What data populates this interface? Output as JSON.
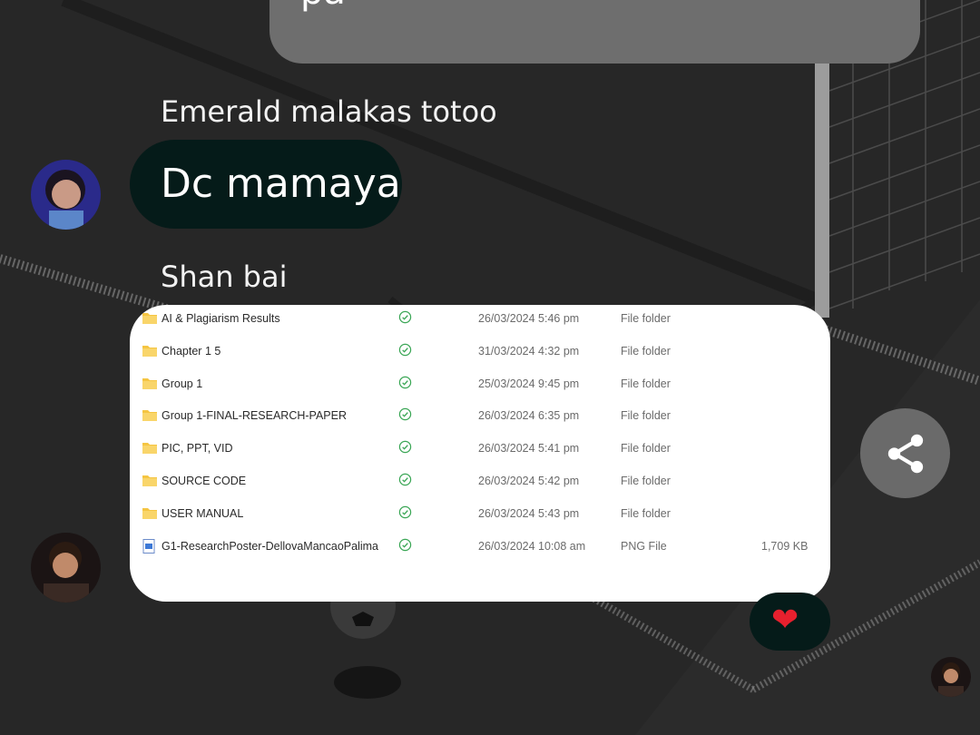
{
  "messages": {
    "top_bubble_text": "pa",
    "sender_1": "Emerald malakas totoo",
    "bubble_1_text": "Dc mamaya",
    "sender_2": "Shan bai"
  },
  "file_list": [
    {
      "name": "AI & Plagiarism Results",
      "date": "26/03/2024 5:46 pm",
      "type": "File folder",
      "size": "",
      "icon": "folder-icon"
    },
    {
      "name": "Chapter 1 5",
      "date": "31/03/2024 4:32 pm",
      "type": "File folder",
      "size": "",
      "icon": "folder-icon"
    },
    {
      "name": "Group 1",
      "date": "25/03/2024 9:45 pm",
      "type": "File folder",
      "size": "",
      "icon": "folder-icon"
    },
    {
      "name": "Group 1-FINAL-RESEARCH-PAPER",
      "date": "26/03/2024 6:35 pm",
      "type": "File folder",
      "size": "",
      "icon": "folder-icon"
    },
    {
      "name": "PIC, PPT, VID",
      "date": "26/03/2024 5:41 pm",
      "type": "File folder",
      "size": "",
      "icon": "folder-icon"
    },
    {
      "name": "SOURCE CODE",
      "date": "26/03/2024 5:42 pm",
      "type": "File folder",
      "size": "",
      "icon": "folder-icon"
    },
    {
      "name": "USER MANUAL",
      "date": "26/03/2024 5:43 pm",
      "type": "File folder",
      "size": "",
      "icon": "folder-icon"
    },
    {
      "name": "G1-ResearchPoster-DellovaMancaoPalima",
      "date": "26/03/2024 10:08 am",
      "type": "PNG File",
      "size": "1,709 KB",
      "icon": "image-file-icon"
    }
  ],
  "reaction": {
    "emoji": "❤"
  },
  "colors": {
    "background": "#2b2b2b",
    "bubble_gray": "#6e6e6e",
    "bubble_dark": "#051b19",
    "folder": "#f5c542",
    "sync_check": "#3aa655",
    "heart": "#e8202e"
  }
}
